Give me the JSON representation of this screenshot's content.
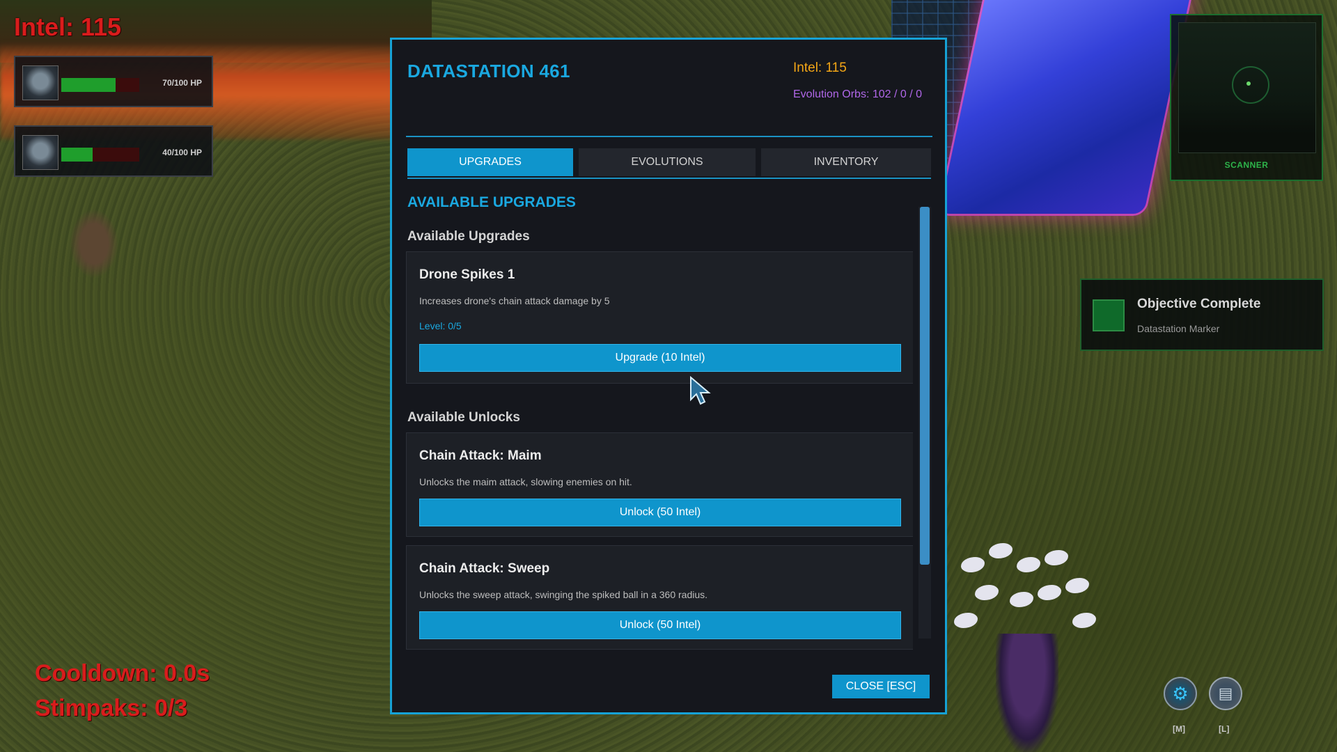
{
  "hud": {
    "intel_text": "Intel: 115",
    "party": [
      {
        "hp_text": "70/100 HP",
        "hp_fraction": 0.7
      },
      {
        "hp_text": "40/100 HP",
        "hp_fraction": 0.4
      }
    ],
    "cooldown_text": "Cooldown: 0.0s",
    "stimpaks_text": "Stimpaks: 0/3"
  },
  "scanner": {
    "label": "SCANNER"
  },
  "objective": {
    "title": "Objective Complete",
    "subtitle": "Datastation Marker"
  },
  "shortcuts": [
    {
      "icon": "gear-icon",
      "key": "[M]"
    },
    {
      "icon": "log-icon",
      "key": "[L]"
    }
  ],
  "modal": {
    "title": "DATASTATION 461",
    "intel": "Intel: 115",
    "orbs": "Evolution Orbs: 102 / 0 / 0",
    "tabs": [
      {
        "label": "UPGRADES",
        "active": true
      },
      {
        "label": "EVOLUTIONS",
        "active": false
      },
      {
        "label": "INVENTORY",
        "active": false
      }
    ],
    "section_title": "AVAILABLE UPGRADES",
    "upgrades_heading": "Available Upgrades",
    "upgrades": [
      {
        "name": "Drone Spikes 1",
        "desc": "Increases drone's chain attack damage by 5",
        "level": "Level: 0/5",
        "button": "Upgrade (10 Intel)"
      }
    ],
    "unlocks_heading": "Available Unlocks",
    "unlocks": [
      {
        "name": "Chain Attack: Maim",
        "desc": "Unlocks the maim attack, slowing enemies on hit.",
        "button": "Unlock (50 Intel)"
      },
      {
        "name": "Chain Attack: Sweep",
        "desc": "Unlocks the sweep attack, swinging the spiked ball in a 360 radius.",
        "button": "Unlock (50 Intel)"
      }
    ],
    "close_label": "CLOSE [ESC]"
  },
  "colors": {
    "accent": "#1aa8e0",
    "intel": "#f3a616",
    "orbs": "#b067e8",
    "hud_red": "#d91c1c",
    "hp_green": "#1f9e2c"
  }
}
